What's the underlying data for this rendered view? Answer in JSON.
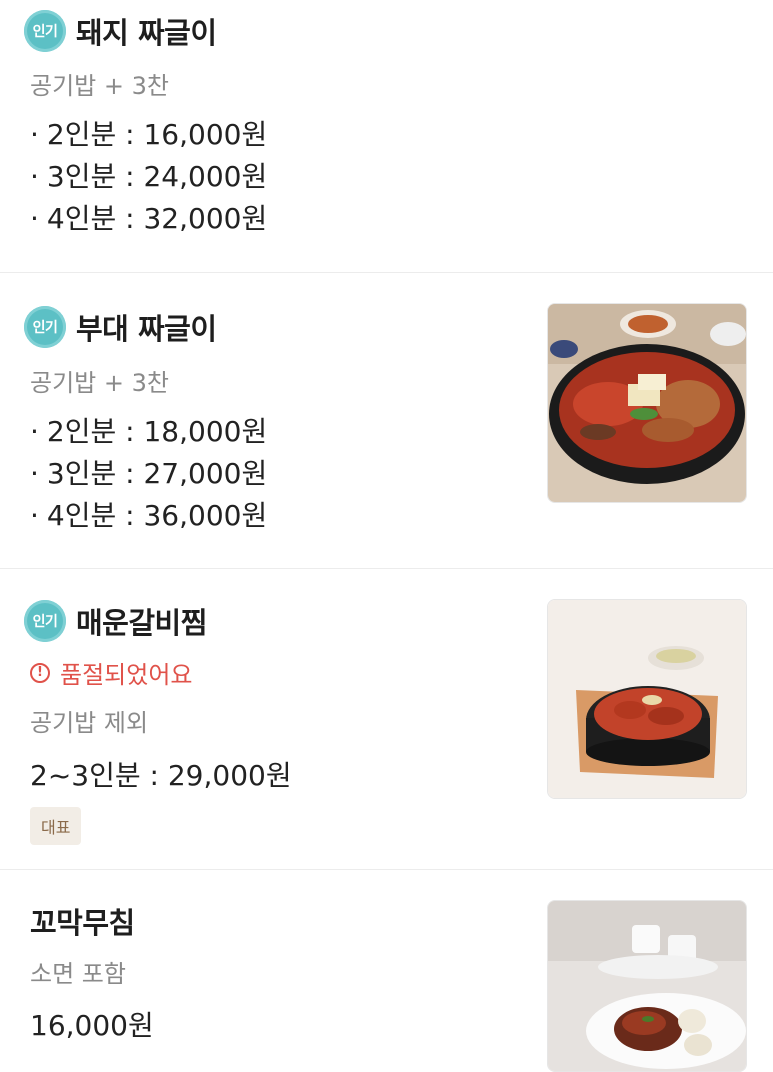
{
  "menu": {
    "items": [
      {
        "badge": "인기",
        "title": "돼지 짜글이",
        "desc": "공기밥 + 3찬",
        "prices": [
          "2인분 : 16,000원",
          "3인분 : 24,000원",
          "4인분 : 32,000원"
        ],
        "image": false
      },
      {
        "badge": "인기",
        "title": "부대 짜글이",
        "desc": "공기밥 + 3찬",
        "prices": [
          "2인분 : 18,000원",
          "3인분 : 27,000원",
          "4인분 : 36,000원"
        ],
        "image": "budae-jjageuli-photo"
      },
      {
        "badge": "인기",
        "title": "매운갈비찜",
        "soldout": "품절되었어요",
        "desc": "공기밥 제외",
        "price": "2~3인분 : 29,000원",
        "tag": "대표",
        "image": "galbijjim-photo"
      },
      {
        "title": "꼬막무침",
        "desc": "소면 포함",
        "price": "16,000원",
        "image": "kkomak-muchim-photo"
      }
    ],
    "bullet": "·",
    "soldout_icon": "!"
  },
  "colors": {
    "badge": "#5cc0c5",
    "soldout": "#e0524a",
    "tag_bg": "#f2ede6",
    "tag_text": "#8b6a4a"
  }
}
